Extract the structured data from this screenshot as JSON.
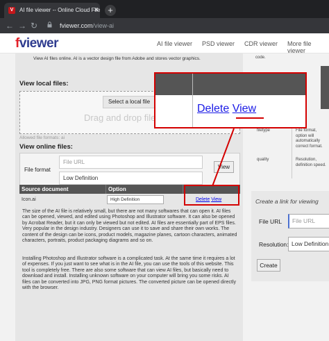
{
  "browser": {
    "tab_title": "AI file viewer -- Online Cloud File",
    "tab_favicon": "V",
    "url_host": "fviewer.com",
    "url_path": "/view-ai"
  },
  "site": {
    "logo_f": "f",
    "logo_rest": "viewer",
    "nav": [
      "AI file viewer",
      "PSD viewer",
      "CDR viewer",
      "More file viewer"
    ]
  },
  "main": {
    "intro": "View AI files online. AI is a vector design file from Adobe and stores vector graphics.",
    "local_title": "View local files:",
    "select_button": "Select a local file",
    "drag_text": "Drag and drop files",
    "allowed": "Allowed file formats:",
    "allowed_ext": "ai",
    "online_title": "View online files:",
    "file_format_label": "File format",
    "file_url_placeholder": "File URL",
    "definition_select": "Low Definition",
    "view_button": "View",
    "table_headers": [
      "Source document",
      "Option",
      ""
    ],
    "row": {
      "file": "Icon.ai",
      "option": "High Definition",
      "delete": "Delete",
      "view": "View"
    },
    "paragraph1": "The size of the AI file is relatively small, but there are not many softwares that can open it. AI files can be opened, viewed, and edited using Photoshop and Illustrator software. It can also be opened by Acrobat Reader, but it can only be viewed but not edited. AI files are essentially part of EPS files. Very popular in the design industry. Designers can use it to save and share their own works. The content of the design can be icons, product models, magazine planes, cartoon characters, animated characters, portraits, product packaging diagrams and so on.",
    "paragraph2": "Installing Photoshop and Illustrator software is a complicated task. At the same time it requires a lot of expenses. If you just want to see what is in the AI file, you can use the tools of this website. This tool is completely free. There are also some software that can view AI files, but basically need to download and install. Installing unknown software on your computer will bring you some risks. AI files can be converted into JPG, PNG format pictures. The converted picture can be opened directly with the browser."
  },
  "sidebar": {
    "code": "code.",
    "rows": [
      {
        "key": "filetype",
        "value": "File format, option will automatically correct format."
      },
      {
        "key": "quality",
        "value": "Resolution, definition speed."
      }
    ],
    "create_title": "Create a link for viewing",
    "file_url_label": "File URL",
    "file_url_placeholder": "File URL",
    "resolution_label": "Resolution:",
    "resolution_value": "Low Definition",
    "create_button": "Create"
  },
  "zoom": {
    "delete": "Delete",
    "view": "View"
  },
  "colors": {
    "highlight": "#d40000",
    "brand_blue": "#2f3c8f",
    "brand_red": "#e32027",
    "table_header": "#555555",
    "link": "#1a1ae6"
  }
}
